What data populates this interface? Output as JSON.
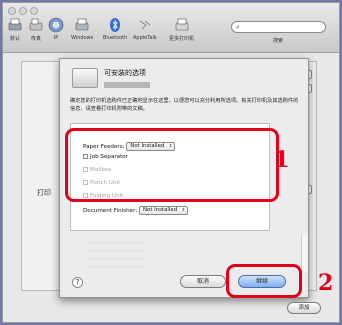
{
  "toolbar": {
    "default_label": "默认",
    "fax_label": "传真",
    "ip_label": "IP",
    "windows_label": "Windows",
    "bluetooth_label": "Bluetooth",
    "appletalk_label": "AppleTalk",
    "more_label": "更多打印机",
    "search_label": "搜索"
  },
  "background": {
    "printer_label": "打印"
  },
  "sheet": {
    "title": "可安装的选项",
    "description": "确定您的打印机选购件已正确地显示在这里，以便您可以充分利用所选项。有关打印机及其选购件的信息，请查看打印机附带的文稿。",
    "options": {
      "paper_feeders_label": "Paper Feeders:",
      "paper_feeders_value": "Not Installed",
      "job_separator_label": "Job Separator",
      "mailbox_label": "Mailbox",
      "punch_unit_label": "Punch Unit",
      "folding_unit_label": "Folding Unit",
      "document_finisher_label": "Document Finisher:",
      "document_finisher_value": "Not Installed"
    },
    "help_label": "?",
    "cancel_label": "取消",
    "continue_label": "继续"
  },
  "add_label": "添加",
  "callouts": {
    "one": "1",
    "two": "2",
    "color": "#e0001c"
  },
  "icons": [
    "default-printer-icon",
    "fax-icon",
    "ip-icon",
    "windows-icon",
    "bluetooth-icon",
    "appletalk-icon",
    "more-printers-icon",
    "search-icon",
    "printer-sheet-icon",
    "help-icon"
  ]
}
